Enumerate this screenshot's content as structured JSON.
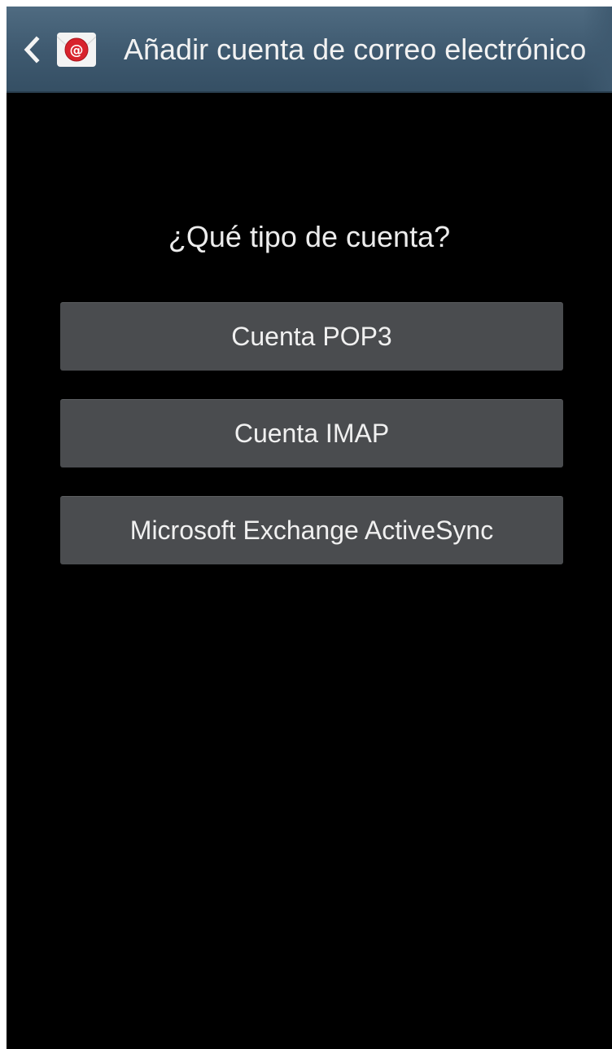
{
  "action_bar": {
    "back_icon": "chevron-left-icon",
    "app_icon": "email-at-envelope-icon",
    "title": "Añadir cuenta de correo electrónico",
    "bar_color": "#3e596f"
  },
  "main": {
    "question": "¿Qué tipo de cuenta?",
    "options": [
      {
        "label": "Cuenta POP3"
      },
      {
        "label": "Cuenta IMAP"
      },
      {
        "label": "Microsoft Exchange ActiveSync"
      }
    ],
    "button_color": "#4a4c4f",
    "background": "#000000"
  }
}
